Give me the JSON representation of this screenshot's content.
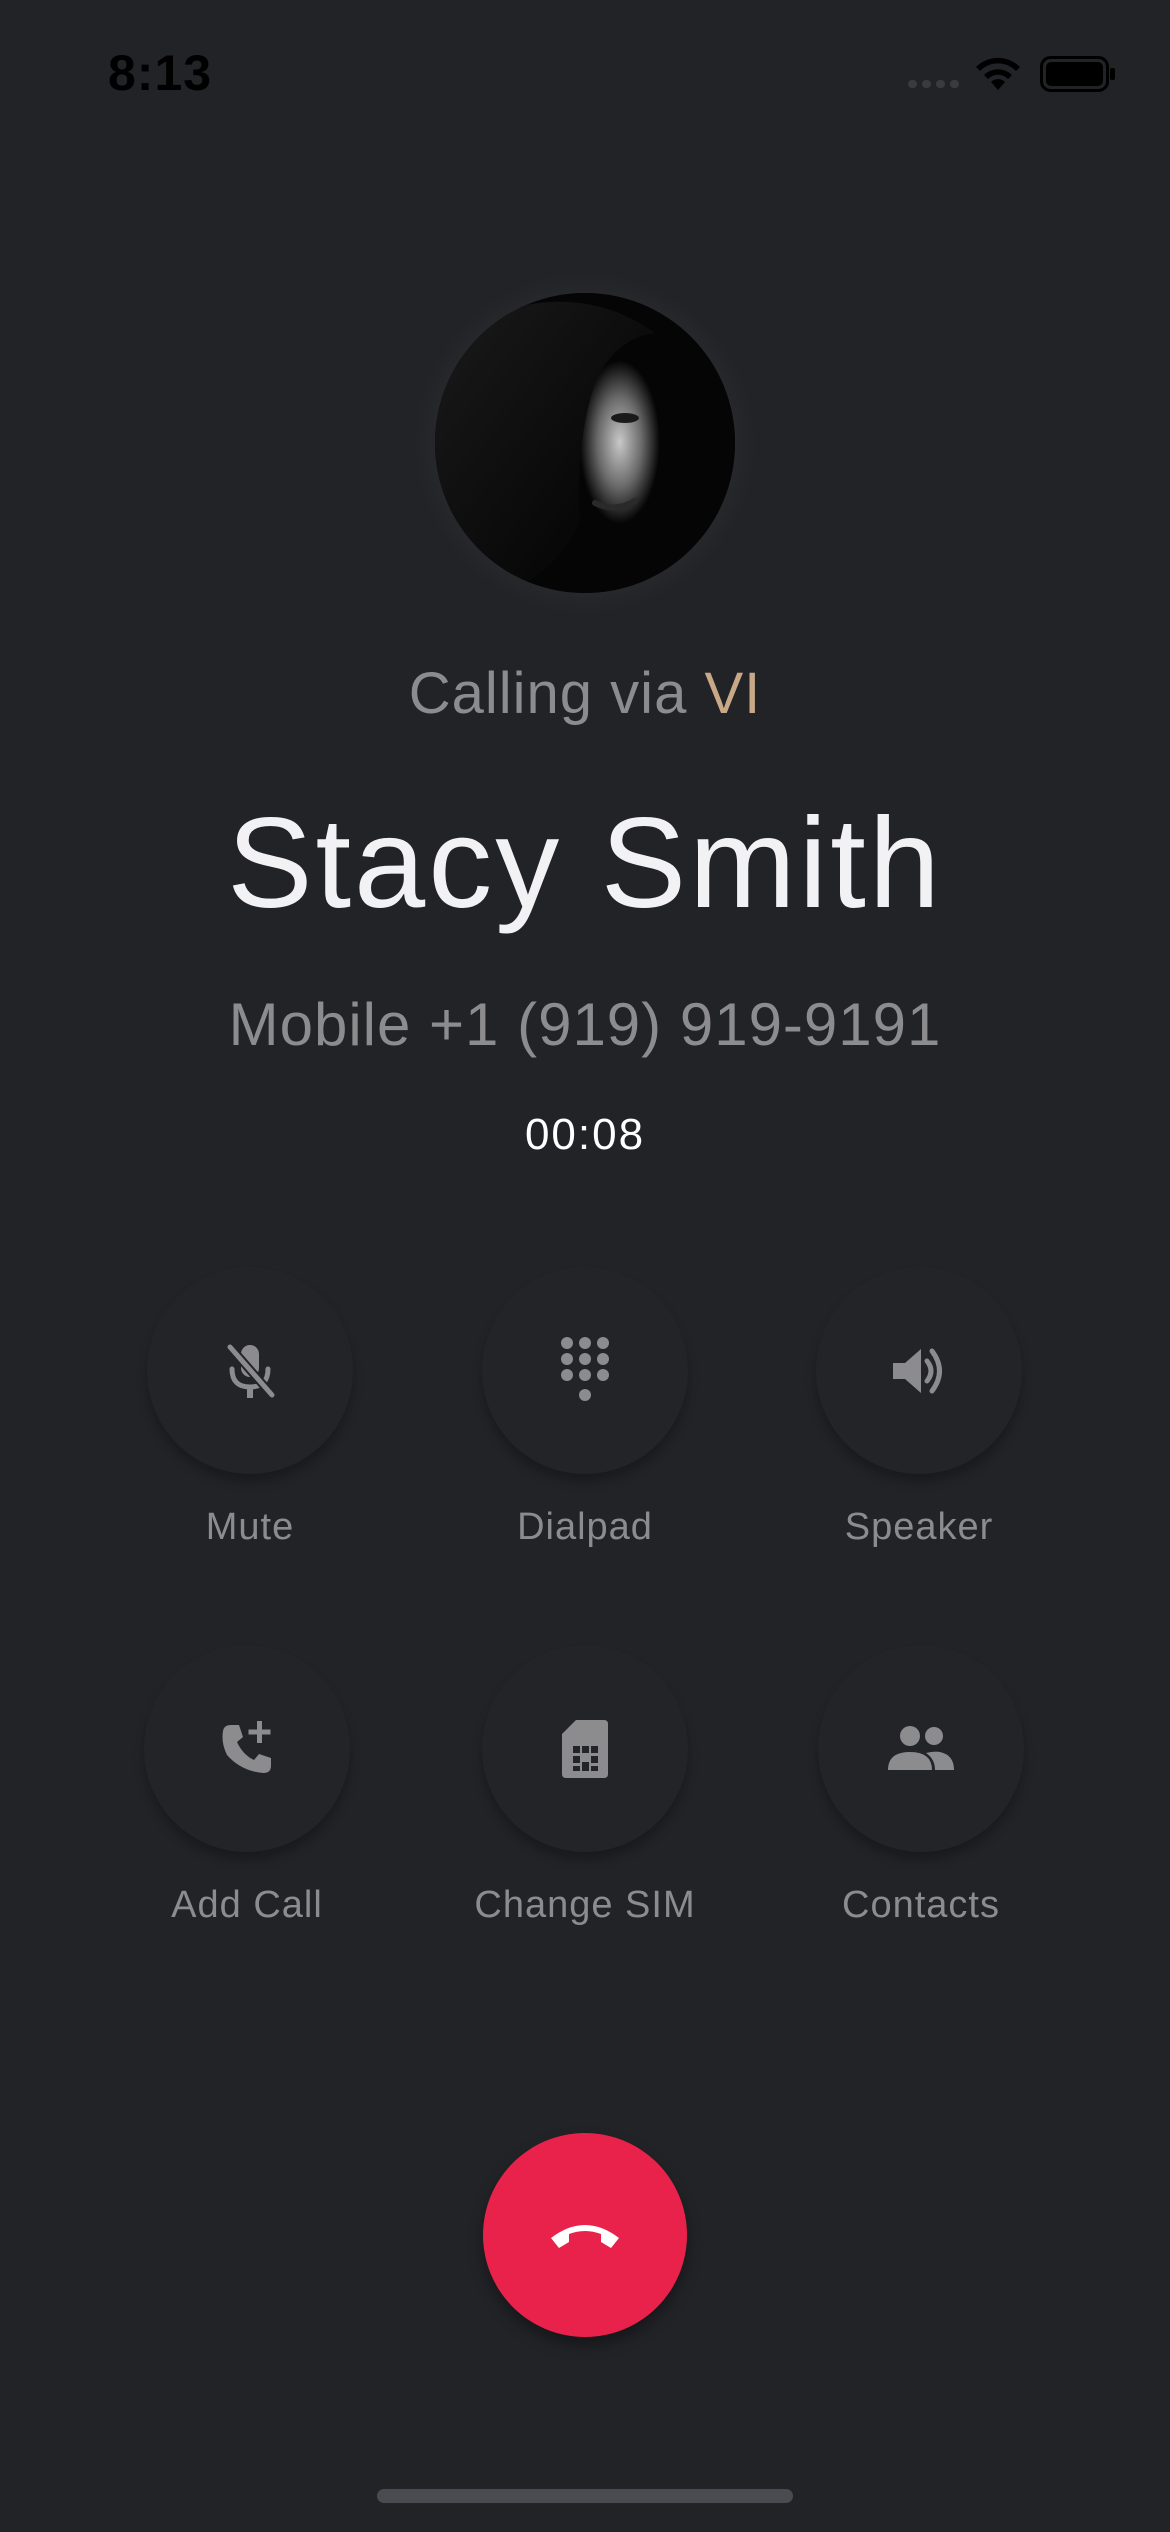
{
  "status_bar": {
    "time": "8:13"
  },
  "call": {
    "calling_via_prefix": "Calling via ",
    "carrier": "VI",
    "contact_name": "Stacy Smith",
    "phone_line": "Mobile +1 (919) 919-9191",
    "timer": "00:08"
  },
  "actions": [
    {
      "label": "Mute",
      "icon": "mic-off-icon"
    },
    {
      "label": "Dialpad",
      "icon": "dialpad-icon"
    },
    {
      "label": "Speaker",
      "icon": "speaker-icon"
    },
    {
      "label": "Add Call",
      "icon": "add-call-icon"
    },
    {
      "label": "Change SIM",
      "icon": "sim-card-icon"
    },
    {
      "label": "Contacts",
      "icon": "contacts-icon"
    }
  ],
  "colors": {
    "background": "#222327",
    "end_call": "#e8224a",
    "carrier_accent": "#c9a888",
    "muted_text": "#8c8c8f"
  }
}
